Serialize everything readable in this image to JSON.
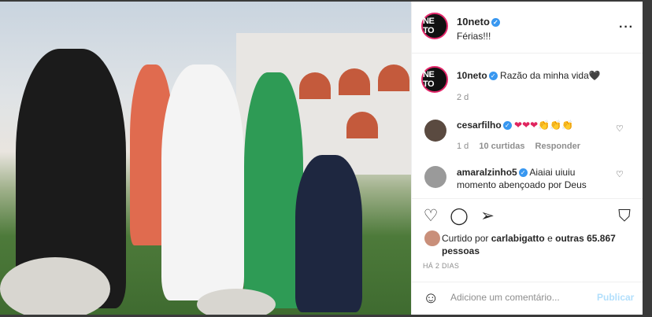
{
  "post": {
    "username": "10neto",
    "caption": "Férias!!!",
    "avatar_text": "NE TO"
  },
  "comments": [
    {
      "user": "10neto",
      "text": "Razão da minha vida🖤",
      "age": "2 d"
    },
    {
      "user": "cesarfilho",
      "text": "❤❤❤👏👏👏",
      "age": "1 d",
      "likes": "10 curtidas",
      "reply": "Responder"
    },
    {
      "user": "amaralzinho5",
      "text": "Aiaiai uiuiu momento abençoado por Deus Férias em família ❤❤❤❤❤",
      "text_visible": "Aiaiai uiuiu momento abençoado por Deus"
    }
  ],
  "likes": {
    "prefix": "Curtido por",
    "user": "carlabigatto",
    "conj": "e",
    "others": "outras 65.867 pessoas"
  },
  "timestamp": "HÁ 2 DIAS",
  "add_comment": {
    "placeholder": "Adicione um comentário...",
    "publish": "Publicar"
  },
  "icons": [
    "heart-icon",
    "comment-icon",
    "share-icon",
    "bookmark-icon",
    "emoji-icon",
    "more-icon"
  ],
  "colors": {
    "verified": "#3897f0",
    "link": "#b2dffc",
    "avatar_ring": "#e3276a"
  }
}
